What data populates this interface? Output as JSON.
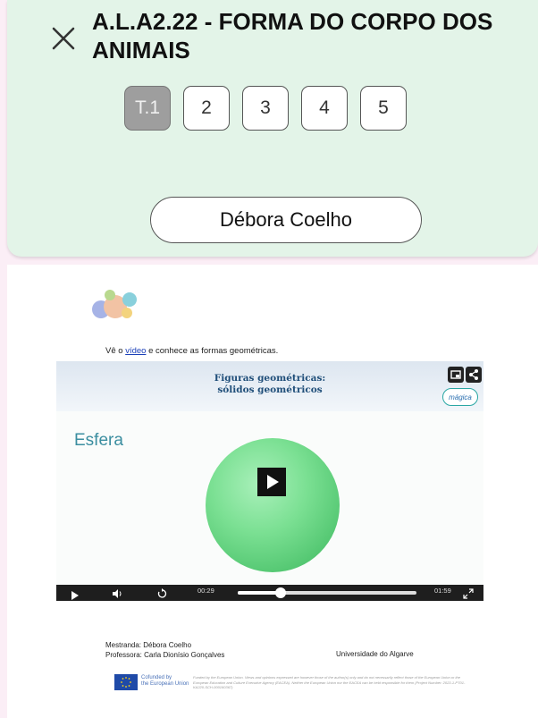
{
  "header": {
    "title": "A.L.A2.22 - FORMA DO CORPO DOS ANIMAIS",
    "close_icon": "close-icon",
    "tabs": [
      {
        "label": "T.1",
        "active": true
      },
      {
        "label": "2",
        "active": false
      },
      {
        "label": "3",
        "active": false
      },
      {
        "label": "4",
        "active": false
      },
      {
        "label": "5",
        "active": false
      }
    ],
    "student_name": "Débora Coelho"
  },
  "document": {
    "logo_icon": "mip-logo",
    "intro_prefix": "Vê o ",
    "intro_link": "vídeo",
    "intro_suffix": " e conhece as formas geométricas.",
    "video": {
      "title_line1": "Figuras geométricas:",
      "title_line2": "sólidos geométricos",
      "shape_label": "Esfera",
      "brand": "mágica",
      "current_time": "00:29",
      "duration": "01:59",
      "progress": 0.24,
      "icons": [
        "pip-icon",
        "share-icon",
        "play-icon",
        "volume-icon",
        "replay-icon",
        "fullscreen-icon"
      ]
    },
    "mestranda": "Mestranda: Débora Coelho",
    "professora": "Professora: Carla Dionísio Gonçalves",
    "university": "Universidade do Algarve",
    "eu_line1": "Cofunded by",
    "eu_line2": "the European Union",
    "disclaimer": "Funded by the European Union. Views and opinions expressed are however those of the author(s) only and do not necessarily reflect those of the European Union or the European Education and Culture Executive Agency (EACEA). Neither the European Union nor the EACEA can be held responsible for them (Project Number: 2023-1-PT01-KA220-SCH-000160367)"
  },
  "colors": {
    "header_bg": "#e3f4e8",
    "page_bg": "#fbeef6",
    "active_tab": "#9e9e9e",
    "sphere": "#6fd889",
    "video_title": "#1f4e79",
    "link": "#1a3fb8"
  }
}
